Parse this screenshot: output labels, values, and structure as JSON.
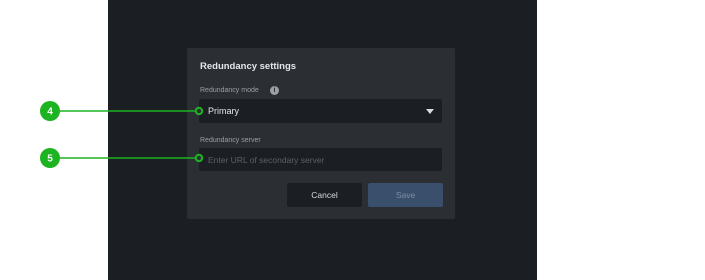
{
  "dialog": {
    "title": "Redundancy settings",
    "mode_label": "Redundancy mode",
    "mode_info_icon": "info-icon",
    "mode_value": "Primary",
    "server_label": "Redundancy server",
    "server_placeholder": "Enter URL of secondary server",
    "server_value": "",
    "cancel_label": "Cancel",
    "save_label": "Save",
    "save_enabled": false
  },
  "callouts": [
    {
      "number": "4",
      "target": "redundancy-mode-select"
    },
    {
      "number": "5",
      "target": "redundancy-server-input"
    }
  ],
  "colors": {
    "callout_green": "#1db321",
    "screen_bg": "#1b1e22",
    "dialog_bg": "#2b2e33",
    "save_disabled_bg": "#3a4f6b"
  }
}
